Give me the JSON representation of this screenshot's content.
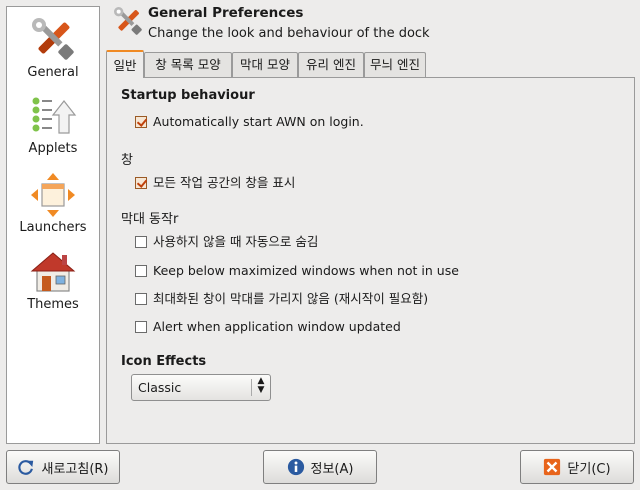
{
  "sidebar": {
    "items": [
      {
        "label": "General",
        "icon": "tools-icon"
      },
      {
        "label": "Applets",
        "icon": "applets-icon"
      },
      {
        "label": "Launchers",
        "icon": "launchers-icon"
      },
      {
        "label": "Themes",
        "icon": "home-icon"
      }
    ]
  },
  "header": {
    "title": "General Preferences",
    "subtitle": "Change the look and behaviour of the dock"
  },
  "tabs": [
    {
      "label": "일반",
      "active": true
    },
    {
      "label": "창 목록 모양"
    },
    {
      "label": "막대 모양"
    },
    {
      "label": "유리 엔진"
    },
    {
      "label": "무늬 엔진"
    }
  ],
  "sections": {
    "startup": {
      "title": "Startup behaviour",
      "autostart": {
        "label": "Automatically start AWN on login.",
        "checked": true
      }
    },
    "window": {
      "title": "창",
      "show_all_ws": {
        "label": "모든 작업 공간의 창을 표시",
        "checked": true
      }
    },
    "bar": {
      "title": "막대 동작r",
      "autohide": {
        "label": "사용하지 않을 때 자동으로 숨김",
        "checked": false
      },
      "keep_below": {
        "label": "Keep below maximized windows when not in use",
        "checked": false
      },
      "no_cover": {
        "label": "최대화된 창이 막대를 가리지 않음 (재시작이 필요함)",
        "checked": false
      },
      "alert": {
        "label": "Alert when application window updated",
        "checked": false
      }
    },
    "icon_effects": {
      "title": "Icon Effects",
      "selected": "Classic"
    }
  },
  "buttons": {
    "refresh": "새로고침(R)",
    "about": "정보(A)",
    "close": "닫기(C)"
  },
  "colors": {
    "accent": "#f08a24",
    "check": "#c0400a",
    "close_icon": "#e8641b",
    "info_icon": "#2a5aa0"
  }
}
